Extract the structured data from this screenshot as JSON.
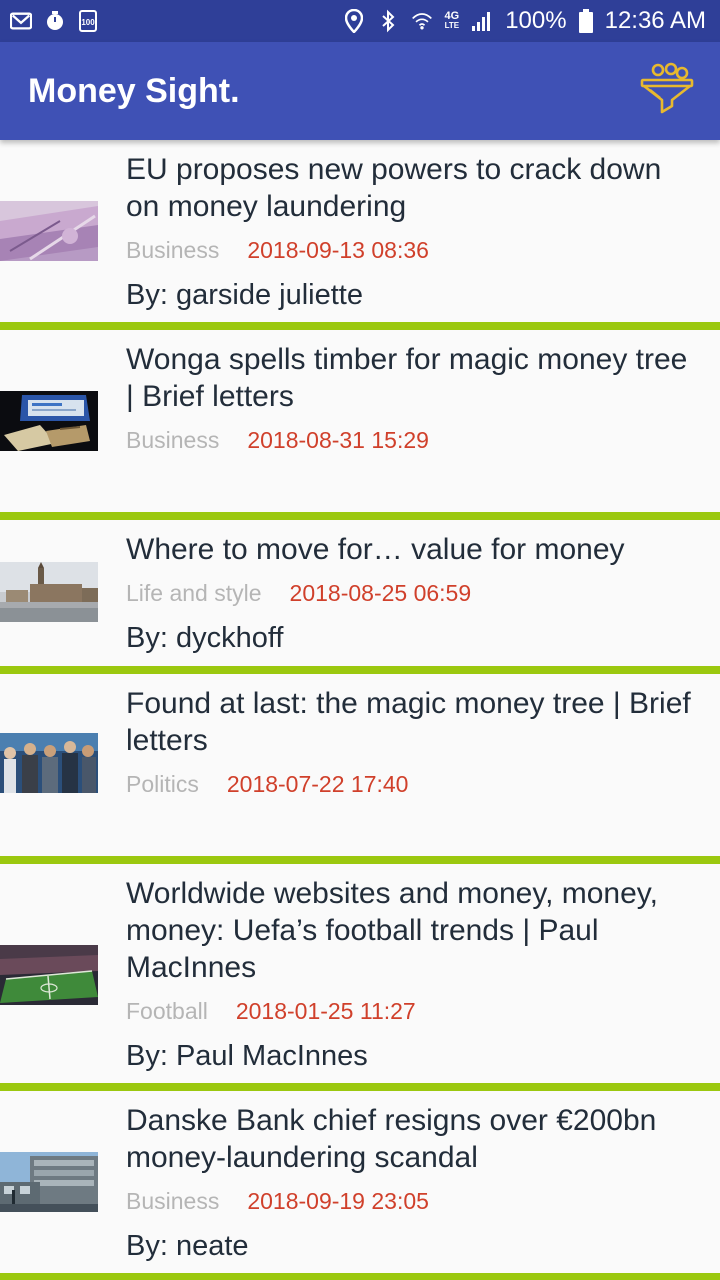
{
  "status_bar": {
    "battery_percent": "100%",
    "time": "12:36 AM",
    "notification_count": "100",
    "network": "4G",
    "network_sub": "LTE",
    "icons": [
      "gmail-icon",
      "timer-icon",
      "notification-count-icon",
      "location-icon",
      "bluetooth-icon",
      "wifi-icon",
      "4g-lte-icon",
      "signal-icon",
      "battery-icon"
    ]
  },
  "app_bar": {
    "title": "Money Sight.",
    "filter_icon": "filter-coins-icon",
    "accent_color": "#e8b92e",
    "background_color": "#3f51b5"
  },
  "articles": [
    {
      "headline": "EU proposes new powers to crack down on money laundering",
      "category": "Business",
      "date": "2018-09-13 08:36",
      "byline": "By: garside juliette",
      "thumbnail": "banknotes-thumbnail"
    },
    {
      "headline": "Wonga spells timber for magic money tree | Brief letters",
      "category": "Business",
      "date": "2018-08-31 15:29",
      "byline": "",
      "thumbnail": "laptop-cash-thumbnail"
    },
    {
      "headline": "Where to move for… value for money",
      "category": "Life and style",
      "date": "2018-08-25 06:59",
      "byline": "By: dyckhoff",
      "thumbnail": "town-hall-thumbnail"
    },
    {
      "headline": "Found at last: the magic money tree | Brief letters",
      "category": "Politics",
      "date": "2018-07-22 17:40",
      "byline": "",
      "thumbnail": "crowd-thumbnail"
    },
    {
      "headline": "Worldwide websites and money, money, money: Uefa’s football trends   | Paul MacInnes",
      "category": "Football",
      "date": "2018-01-25 11:27",
      "byline": "By: Paul MacInnes",
      "thumbnail": "stadium-thumbnail"
    },
    {
      "headline": "Danske Bank chief resigns over €200bn money-laundering scandal",
      "category": "Business",
      "date": "2018-09-19 23:05",
      "byline": "By: neate",
      "thumbnail": "bank-building-thumbnail"
    }
  ],
  "divider_color": "#9bc80f",
  "date_color": "#d0402b"
}
